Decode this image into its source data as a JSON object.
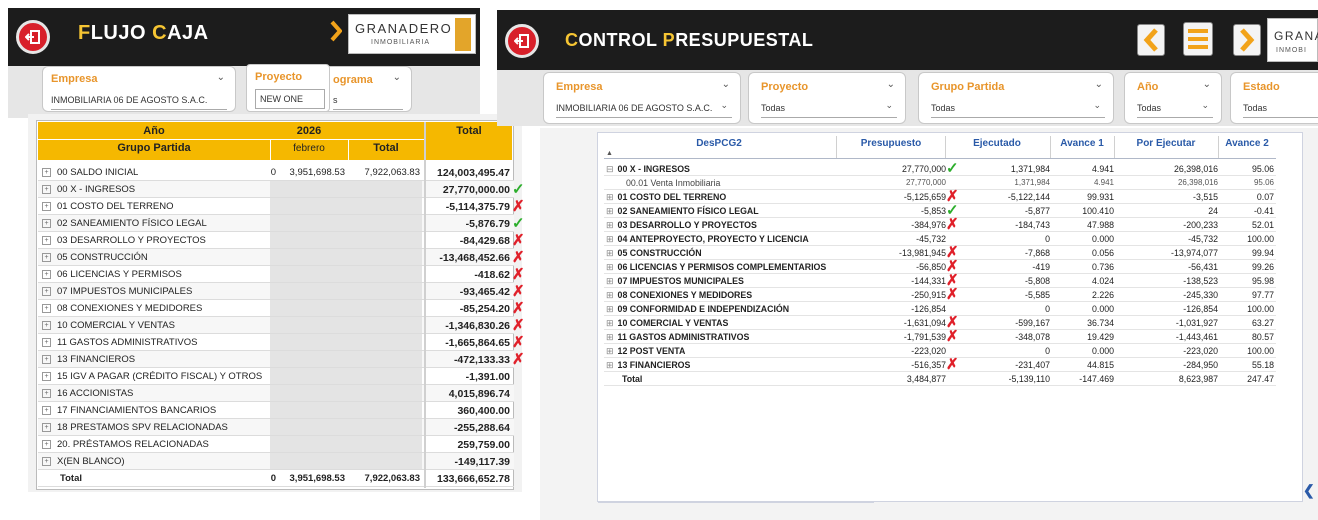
{
  "flujo": {
    "title_pre": "F",
    "title_a": "LUJO ",
    "title_c": "C",
    "title_b": "AJA",
    "logo_brand": "GRANADERO",
    "logo_sub": "INMOBILIARIA",
    "slicers": {
      "empresa_label": "Empresa",
      "empresa_value": "INMOBILIARIA 06 DE AGOSTO S.A.C.",
      "proyecto_label": "Proyecto",
      "proyecto_value": "NEW ONE",
      "cronograma_label": "ograma",
      "cronograma_value": "s"
    },
    "table": {
      "header_year": "Año",
      "year": "2026",
      "header_total": "Total",
      "header_group": "Grupo Partida",
      "header_month": "febrero",
      "header_total2": "Total",
      "rows": [
        {
          "name": "00 SALDO INICIAL",
          "c1": "0",
          "c2": "3,951,698.53",
          "c3": "7,922,063.83",
          "total": "124,003,495.47",
          "mark": ""
        },
        {
          "name": "00 X - INGRESOS",
          "c1": "",
          "c2": "",
          "c3": "",
          "total": "27,770,000.00",
          "mark": "ok"
        },
        {
          "name": "01 COSTO DEL TERRENO",
          "c1": "",
          "c2": "",
          "c3": "",
          "total": "-5,114,375.79",
          "mark": "bad"
        },
        {
          "name": "02 SANEAMIENTO FÍSICO LEGAL",
          "c1": "",
          "c2": "",
          "c3": "",
          "total": "-5,876.79",
          "mark": "ok"
        },
        {
          "name": "03 DESARROLLO Y PROYECTOS",
          "c1": "",
          "c2": "",
          "c3": "",
          "total": "-84,429.68",
          "mark": "bad"
        },
        {
          "name": "05 CONSTRUCCIÓN",
          "c1": "",
          "c2": "",
          "c3": "",
          "total": "-13,468,452.66",
          "mark": "bad"
        },
        {
          "name": "06 LICENCIAS Y PERMISOS",
          "c1": "",
          "c2": "",
          "c3": "",
          "total": "-418.62",
          "mark": "bad"
        },
        {
          "name": "07 IMPUESTOS MUNICIPALES",
          "c1": "",
          "c2": "",
          "c3": "",
          "total": "-93,465.42",
          "mark": "bad"
        },
        {
          "name": "08 CONEXIONES Y MEDIDORES",
          "c1": "",
          "c2": "",
          "c3": "",
          "total": "-85,254.20",
          "mark": "bad"
        },
        {
          "name": "10 COMERCIAL Y VENTAS",
          "c1": "",
          "c2": "",
          "c3": "",
          "total": "-1,346,830.26",
          "mark": "bad"
        },
        {
          "name": "11 GASTOS ADMINISTRATIVOS",
          "c1": "",
          "c2": "",
          "c3": "",
          "total": "-1,665,864.65",
          "mark": "bad"
        },
        {
          "name": "13 FINANCIEROS",
          "c1": "",
          "c2": "",
          "c3": "",
          "total": "-472,133.33",
          "mark": "bad"
        },
        {
          "name": "15 IGV A PAGAR (CRÉDITO FISCAL) Y OTROS",
          "c1": "",
          "c2": "",
          "c3": "",
          "total": "-1,391.00",
          "mark": ""
        },
        {
          "name": "16 ACCIONISTAS",
          "c1": "",
          "c2": "",
          "c3": "",
          "total": "4,015,896.74",
          "mark": ""
        },
        {
          "name": "17 FINANCIAMIENTOS BANCARIOS",
          "c1": "",
          "c2": "",
          "c3": "",
          "total": "360,400.00",
          "mark": ""
        },
        {
          "name": "18 PRESTAMOS SPV RELACIONADAS",
          "c1": "",
          "c2": "",
          "c3": "",
          "total": "-255,288.64",
          "mark": ""
        },
        {
          "name": "20. PRÉSTAMOS RELACIONADAS",
          "c1": "",
          "c2": "",
          "c3": "",
          "total": "259,759.00",
          "mark": ""
        },
        {
          "name": "X(EN BLANCO)",
          "c1": "",
          "c2": "",
          "c3": "",
          "total": "-149,117.39",
          "mark": ""
        },
        {
          "name": "Total",
          "c1": "0",
          "c2": "3,951,698.53",
          "c3": "7,922,063.83",
          "total": "133,666,652.78",
          "mark": ""
        }
      ]
    }
  },
  "control": {
    "title_pre": "C",
    "title_a": "ONTROL ",
    "title_p": "P",
    "title_b": "RESUPUESTAL",
    "logo_brand": "GRANA",
    "logo_sub": "INMOBI",
    "slicers": {
      "empresa_label": "Empresa",
      "empresa_value": "INMOBILIARIA 06 DE AGOSTO S.A.C.",
      "proyecto_label": "Proyecto",
      "proyecto_value": "Todas",
      "grupo_label": "Grupo Partida",
      "grupo_value": "Todas",
      "anio_label": "Año",
      "anio_value": "Todas",
      "estado_label": "Estado",
      "estado_value": "Todas"
    },
    "table": {
      "headers": [
        "DesPCG2",
        "Presupuesto",
        "Ejecutado",
        "Avance 1",
        "Por Ejecutar",
        "Avance 2"
      ],
      "rows": [
        {
          "name": "00 X - INGRESOS",
          "v": [
            "27,770,000",
            "1,371,984",
            "4.941",
            "26,398,016",
            "95.06"
          ],
          "mark": "ok",
          "sign": "⊟",
          "sub": false
        },
        {
          "name": "00.01 Venta Inmobiliaria",
          "v": [
            "27,770,000",
            "1,371,984",
            "4.941",
            "26,398,016",
            "95.06"
          ],
          "mark": "",
          "sign": "",
          "sub": true
        },
        {
          "name": "01 COSTO DEL TERRENO",
          "v": [
            "-5,125,659",
            "-5,122,144",
            "99.931",
            "-3,515",
            "0.07"
          ],
          "mark": "bad",
          "sign": "⊞",
          "sub": false
        },
        {
          "name": "02 SANEAMIENTO FÍSICO LEGAL",
          "v": [
            "-5,853",
            "-5,877",
            "100.410",
            "24",
            "-0.41"
          ],
          "mark": "ok",
          "sign": "⊞",
          "sub": false
        },
        {
          "name": "03 DESARROLLO Y PROYECTOS",
          "v": [
            "-384,976",
            "-184,743",
            "47.988",
            "-200,233",
            "52.01"
          ],
          "mark": "bad",
          "sign": "⊞",
          "sub": false
        },
        {
          "name": "04 ANTEPROYECTO, PROYECTO Y LICENCIA",
          "v": [
            "-45,732",
            "0",
            "0.000",
            "-45,732",
            "100.00"
          ],
          "mark": "",
          "sign": "⊞",
          "sub": false
        },
        {
          "name": "05 CONSTRUCCIÓN",
          "v": [
            "-13,981,945",
            "-7,868",
            "0.056",
            "-13,974,077",
            "99.94"
          ],
          "mark": "bad",
          "sign": "⊞",
          "sub": false
        },
        {
          "name": "06 LICENCIAS Y PERMISOS COMPLEMENTARIOS",
          "v": [
            "-56,850",
            "-419",
            "0.736",
            "-56,431",
            "99.26"
          ],
          "mark": "bad",
          "sign": "⊞",
          "sub": false
        },
        {
          "name": "07 IMPUESTOS MUNICIPALES",
          "v": [
            "-144,331",
            "-5,808",
            "4.024",
            "-138,523",
            "95.98"
          ],
          "mark": "bad",
          "sign": "⊞",
          "sub": false
        },
        {
          "name": "08 CONEXIONES Y MEDIDORES",
          "v": [
            "-250,915",
            "-5,585",
            "2.226",
            "-245,330",
            "97.77"
          ],
          "mark": "bad",
          "sign": "⊞",
          "sub": false
        },
        {
          "name": "09 CONFORMIDAD E INDEPENDIZACIÓN",
          "v": [
            "-126,854",
            "0",
            "0.000",
            "-126,854",
            "100.00"
          ],
          "mark": "",
          "sign": "⊞",
          "sub": false
        },
        {
          "name": "10 COMERCIAL Y VENTAS",
          "v": [
            "-1,631,094",
            "-599,167",
            "36.734",
            "-1,031,927",
            "63.27"
          ],
          "mark": "bad",
          "sign": "⊞",
          "sub": false
        },
        {
          "name": "11 GASTOS ADMINISTRATIVOS",
          "v": [
            "-1,791,539",
            "-348,078",
            "19.429",
            "-1,443,461",
            "80.57"
          ],
          "mark": "bad",
          "sign": "⊞",
          "sub": false
        },
        {
          "name": "12 POST VENTA",
          "v": [
            "-223,020",
            "0",
            "0.000",
            "-223,020",
            "100.00"
          ],
          "mark": "",
          "sign": "⊞",
          "sub": false
        },
        {
          "name": "13 FINANCIEROS",
          "v": [
            "-516,357",
            "-231,407",
            "44.815",
            "-284,950",
            "55.18"
          ],
          "mark": "bad",
          "sign": "⊞",
          "sub": false
        },
        {
          "name": "Total",
          "v": [
            "3,484,877",
            "-5,139,110",
            "-147.469",
            "8,623,987",
            "247.47"
          ],
          "mark": "",
          "sign": "",
          "sub": false
        }
      ]
    }
  },
  "colors": {
    "accent": "#f6c533",
    "label": "#e8952b",
    "header_bg": "#f5b800",
    "ok": "#2cae2c",
    "bad": "#e0202a",
    "col_header": "#2a5aa8"
  }
}
